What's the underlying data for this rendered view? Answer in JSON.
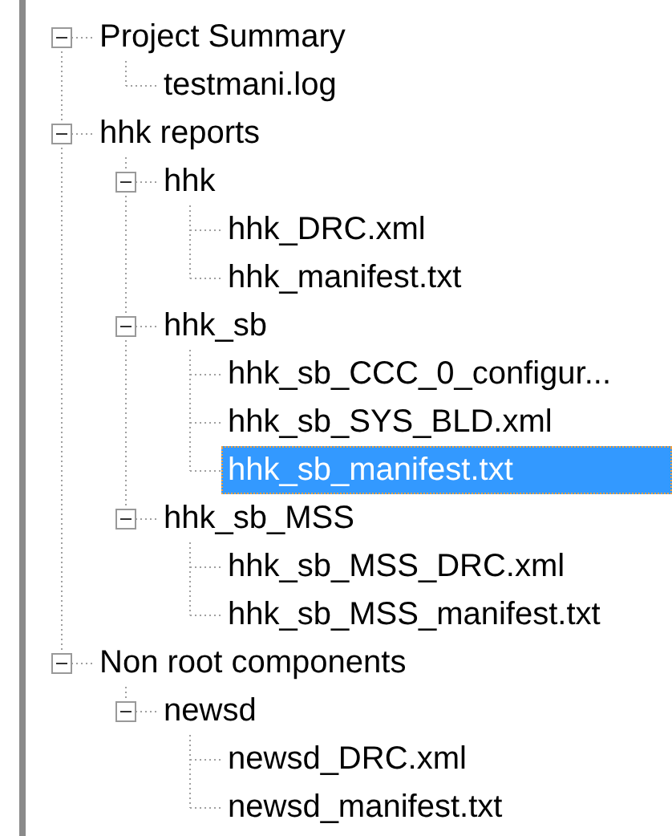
{
  "tree": [
    {
      "label": "Project Summary",
      "expanded": true,
      "selected": false,
      "children": [
        {
          "label": "testmani.log",
          "selected": false
        }
      ]
    },
    {
      "label": "hhk reports",
      "expanded": true,
      "selected": false,
      "children": [
        {
          "label": "hhk",
          "expanded": true,
          "selected": false,
          "children": [
            {
              "label": "hhk_DRC.xml",
              "selected": false
            },
            {
              "label": "hhk_manifest.txt",
              "selected": false
            }
          ]
        },
        {
          "label": "hhk_sb",
          "expanded": true,
          "selected": false,
          "children": [
            {
              "label": "hhk_sb_CCC_0_configur...",
              "selected": false
            },
            {
              "label": "hhk_sb_SYS_BLD.xml",
              "selected": false
            },
            {
              "label": "hhk_sb_manifest.txt",
              "selected": true
            }
          ]
        },
        {
          "label": "hhk_sb_MSS",
          "expanded": true,
          "selected": false,
          "children": [
            {
              "label": "hhk_sb_MSS_DRC.xml",
              "selected": false
            },
            {
              "label": "hhk_sb_MSS_manifest.txt",
              "selected": false
            }
          ]
        }
      ]
    },
    {
      "label": "Non root components",
      "expanded": true,
      "selected": false,
      "children": [
        {
          "label": "newsd",
          "expanded": true,
          "selected": false,
          "children": [
            {
              "label": "newsd_DRC.xml",
              "selected": false
            },
            {
              "label": "newsd_manifest.txt",
              "selected": false
            }
          ]
        }
      ]
    }
  ]
}
